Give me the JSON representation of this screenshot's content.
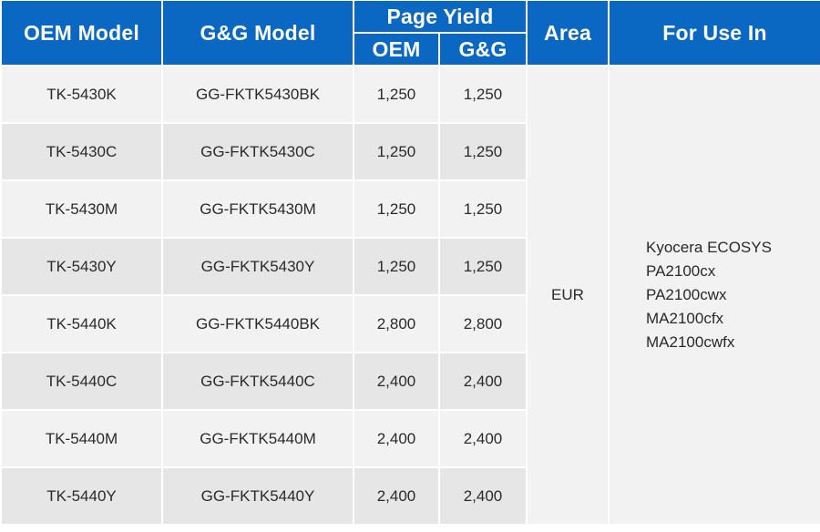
{
  "header": {
    "oem_model": "OEM Model",
    "gg_model": "G&G Model",
    "page_yield": "Page Yield",
    "yield_oem": "OEM",
    "yield_gg": "G&G",
    "area": "Area",
    "for_use_in": "For Use In"
  },
  "colors": {
    "header_bg": "#0a67c2",
    "row_light": "#f2f2f2",
    "row_dark": "#e6e6e6"
  },
  "rows": [
    {
      "oem_model": "TK-5430K",
      "gg_model": "GG-FKTK5430BK",
      "yield_oem": "1,250",
      "yield_gg": "1,250"
    },
    {
      "oem_model": "TK-5430C",
      "gg_model": "GG-FKTK5430C",
      "yield_oem": "1,250",
      "yield_gg": "1,250"
    },
    {
      "oem_model": "TK-5430M",
      "gg_model": "GG-FKTK5430M",
      "yield_oem": "1,250",
      "yield_gg": "1,250"
    },
    {
      "oem_model": "TK-5430Y",
      "gg_model": "GG-FKTK5430Y",
      "yield_oem": "1,250",
      "yield_gg": "1,250"
    },
    {
      "oem_model": "TK-5440K",
      "gg_model": "GG-FKTK5440BK",
      "yield_oem": "2,800",
      "yield_gg": "2,800"
    },
    {
      "oem_model": "TK-5440C",
      "gg_model": "GG-FKTK5440C",
      "yield_oem": "2,400",
      "yield_gg": "2,400"
    },
    {
      "oem_model": "TK-5440M",
      "gg_model": "GG-FKTK5440M",
      "yield_oem": "2,400",
      "yield_gg": "2,400"
    },
    {
      "oem_model": "TK-5440Y",
      "gg_model": "GG-FKTK5440Y",
      "yield_oem": "2,400",
      "yield_gg": "2,400"
    }
  ],
  "area": "EUR",
  "for_use_in": [
    "Kyocera ECOSYS",
    "PA2100cx",
    "PA2100cwx",
    "MA2100cfx",
    "MA2100cwfx"
  ]
}
